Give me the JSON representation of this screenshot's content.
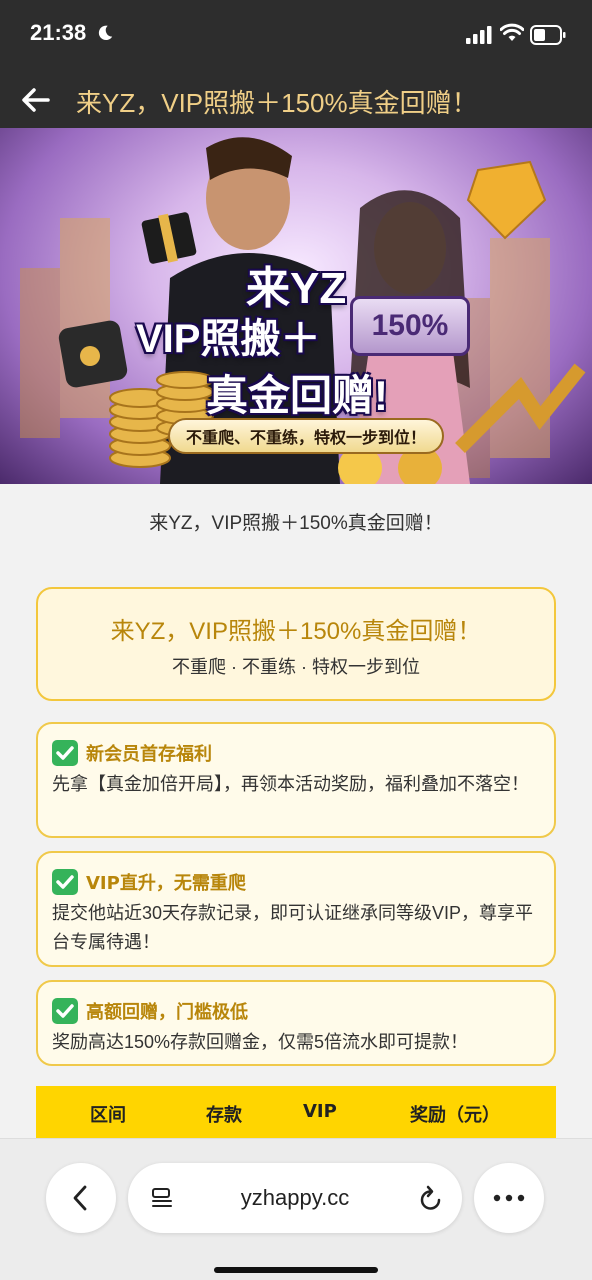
{
  "status_bar": {
    "time": "21:38"
  },
  "header": {
    "title": "来YZ，VIP照搬＋150%真金回赠！"
  },
  "banner": {
    "line1": "来YZ",
    "line2": "VIP照搬＋",
    "percent": "150%",
    "line3": "真金回赠!",
    "tagline": "不重爬、不重练，特权一步到位！"
  },
  "page": {
    "subtitle": "来YZ，VIP照搬＋150%真金回赠！",
    "hero_title": "来YZ，VIP照搬＋150%真金回赠！",
    "hero_subtitle": "不重爬 · 不重练 · 特权一步到位",
    "features": [
      {
        "title": "新会员首存福利",
        "text": "先拿【真金加倍开局】，再领本活动奖励，福利叠加不落空！"
      },
      {
        "title": "VIP直升，无需重爬",
        "text": "提交他站近30天存款记录，即可认证继承同等级VIP，尊享平台专属待遇！"
      },
      {
        "title": "高额回赠，门槛极低",
        "text": "奖励高达150%存款回赠金，仅需5倍流水即可提款！"
      }
    ],
    "table_headers": [
      "区间",
      "存款",
      "VIP",
      "奖励（元）"
    ]
  },
  "browser": {
    "url": "yzhappy.cc"
  },
  "colors": {
    "accent_gold": "#b8860b",
    "header_bg": "#2d2d2d",
    "table_head": "#ffd500"
  }
}
